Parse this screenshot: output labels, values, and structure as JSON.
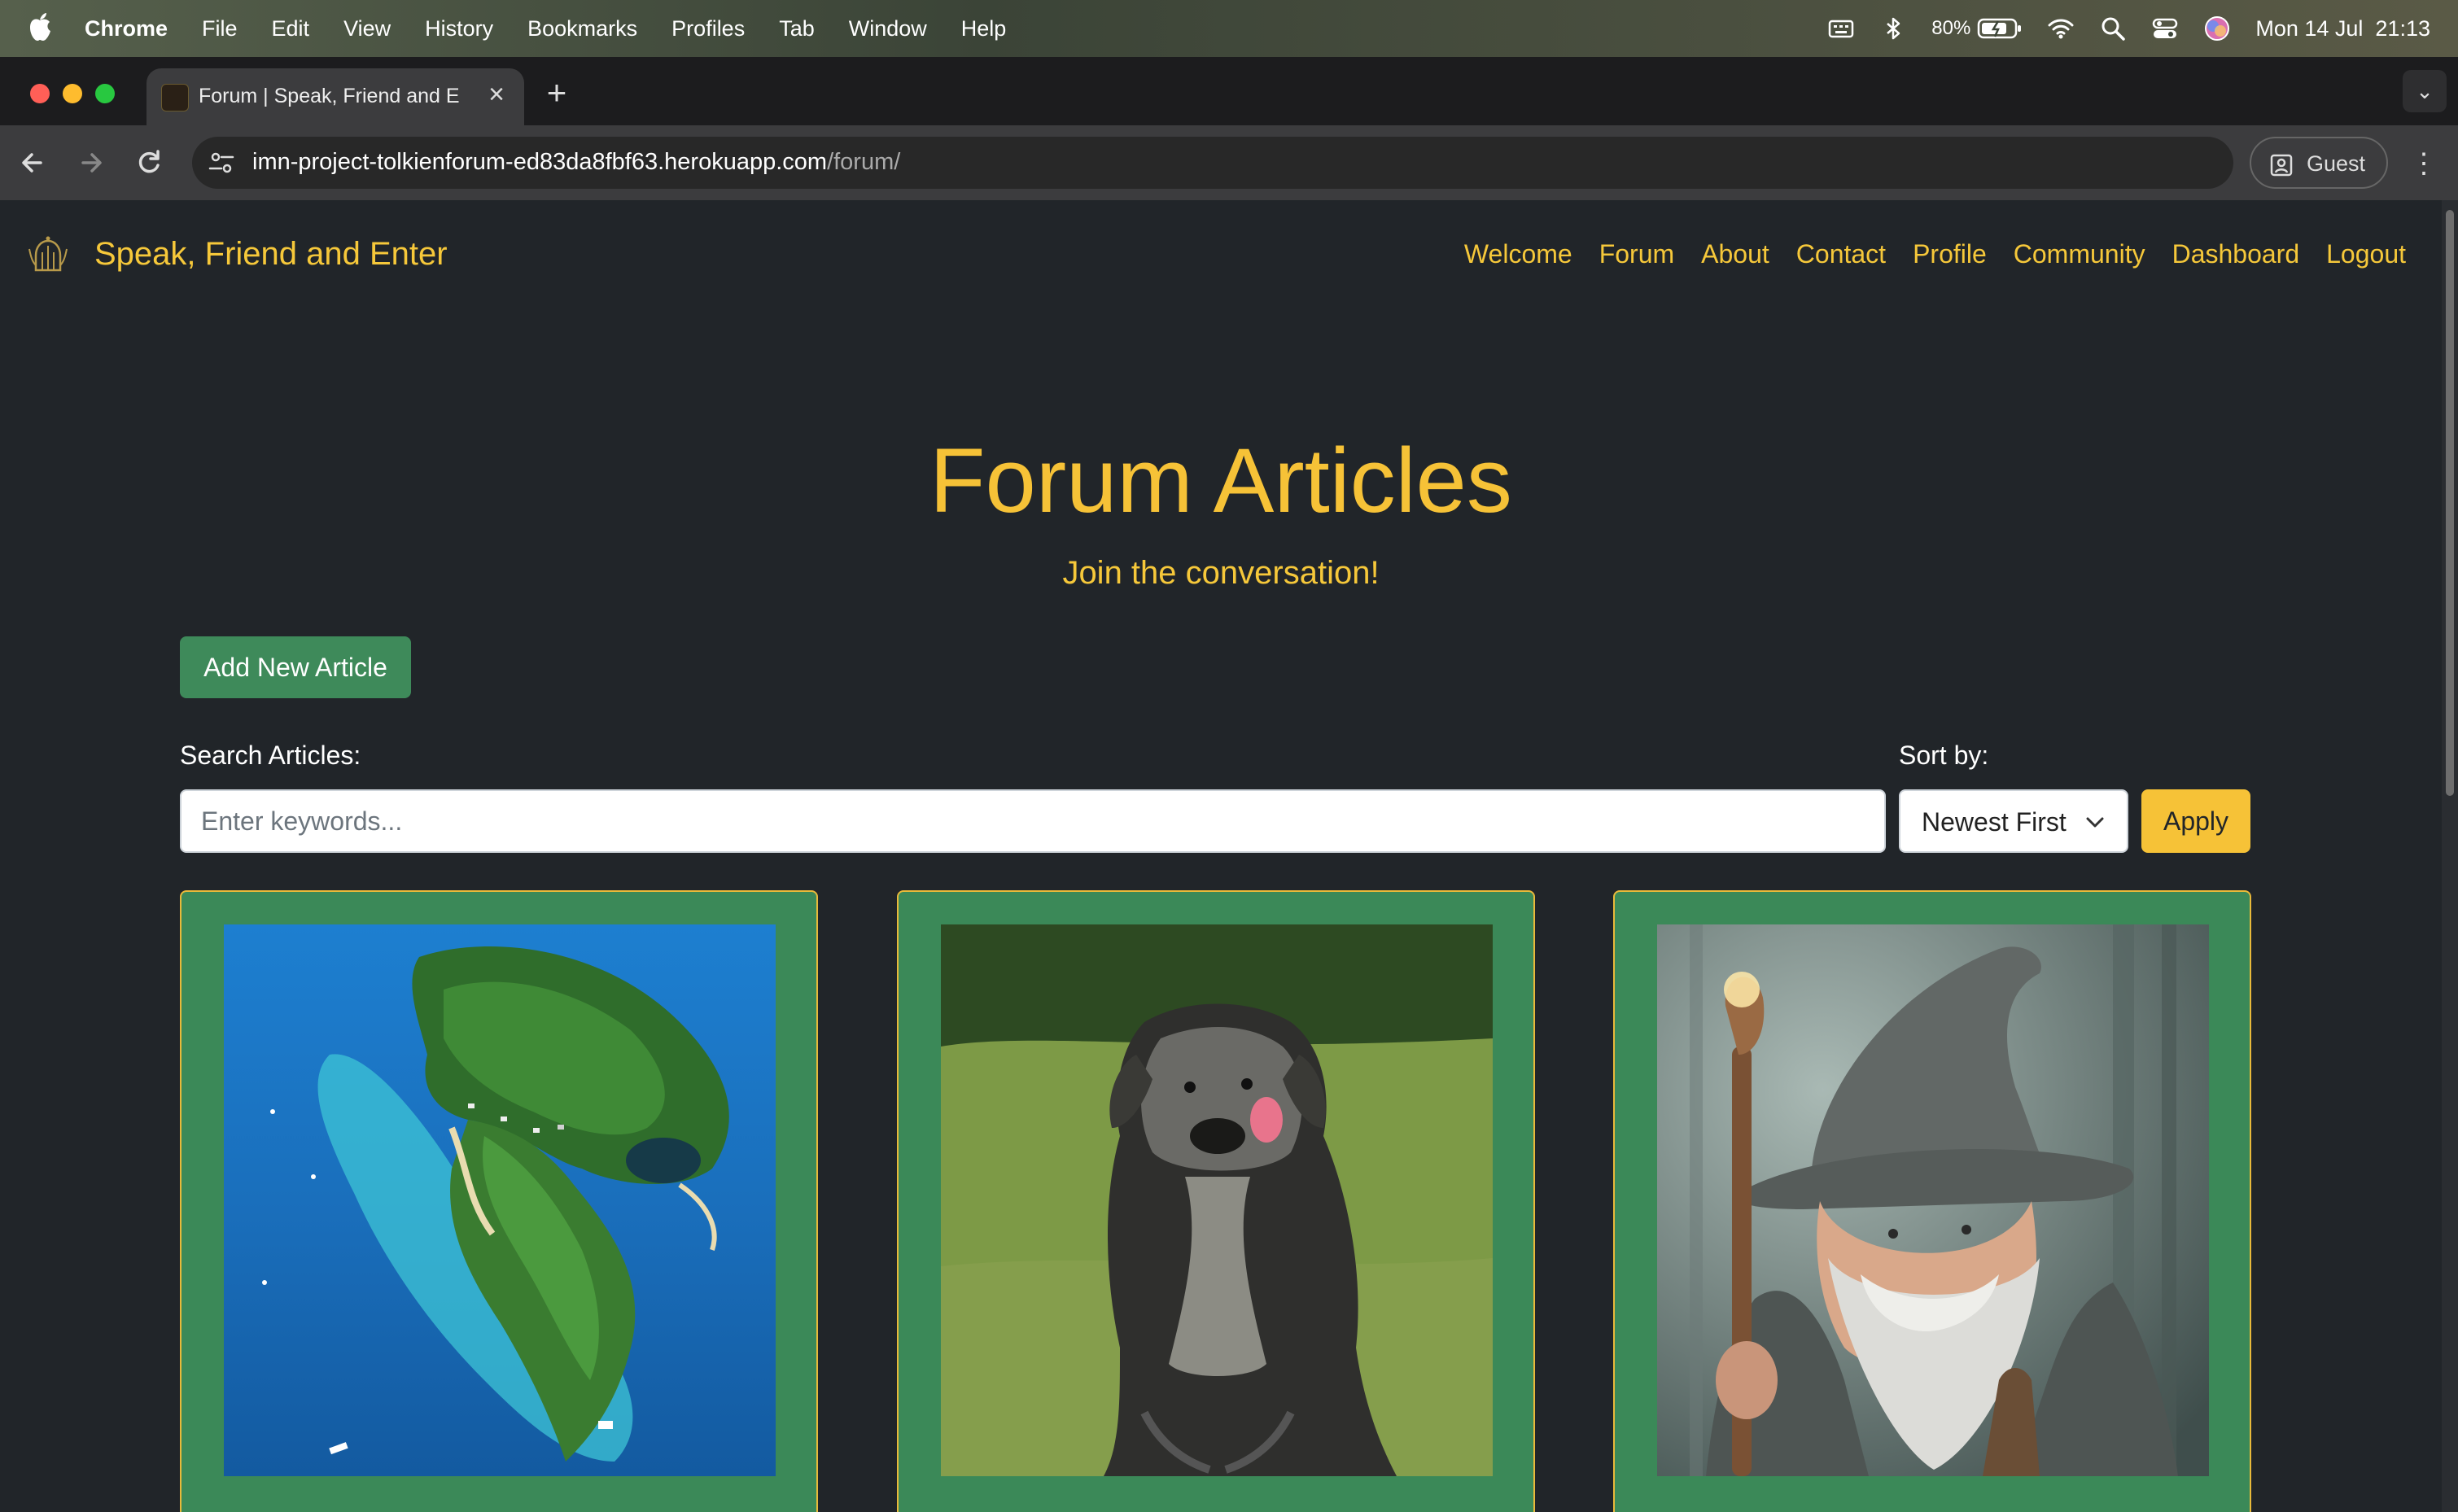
{
  "os_menubar": {
    "app_name": "Chrome",
    "menus": [
      "File",
      "Edit",
      "View",
      "History",
      "Bookmarks",
      "Profiles",
      "Tab",
      "Window",
      "Help"
    ],
    "battery": "80%",
    "datetime": "Mon 14 Jul  21:13"
  },
  "browser": {
    "tab_title": "Forum | Speak, Friend and Enter",
    "url_host": "imn-project-tolkienforum-ed83da8fbf63.herokuapp.com",
    "url_path": "/forum/",
    "profile_label": "Guest"
  },
  "site": {
    "brand": "Speak, Friend and Enter",
    "nav": [
      "Welcome",
      "Forum",
      "About",
      "Contact",
      "Profile",
      "Community",
      "Dashboard",
      "Logout"
    ]
  },
  "main": {
    "heading": "Forum Articles",
    "subheading": "Join the conversation!",
    "add_button": "Add New Article",
    "search_label": "Search Articles:",
    "search_placeholder": "Enter keywords...",
    "search_value": "",
    "sort_label": "Sort by:",
    "sort_selected": "Newest First",
    "apply_button": "Apply"
  },
  "articles": [
    {
      "image": "aerial-island-photo"
    },
    {
      "image": "dog-photo"
    },
    {
      "image": "wizard-portrait"
    }
  ],
  "colors": {
    "accent_yellow": "#f6c237",
    "card_green": "#3b8958",
    "button_green": "#3e8a5a",
    "page_bg": "#212529"
  }
}
